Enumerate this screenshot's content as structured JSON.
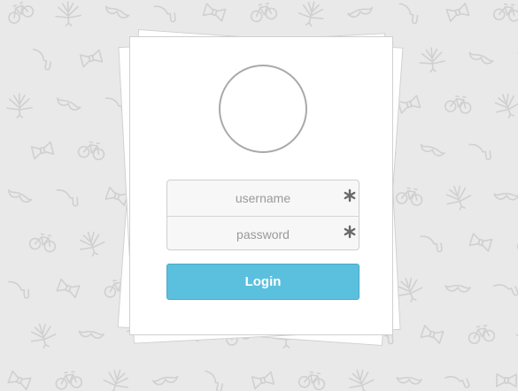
{
  "login_form": {
    "username_placeholder": "username",
    "password_placeholder": "password",
    "required_icon": "asterisk-icon",
    "submit_label": "Login"
  },
  "background": {
    "pattern_icons": [
      "bicycle-icon",
      "mustache-icon",
      "bowtie-icon",
      "leaf-icon",
      "pipe-icon"
    ]
  },
  "colors": {
    "page_background": "#e9e9e9",
    "button": "#5bc0de",
    "pattern": "#d2d2d2"
  }
}
